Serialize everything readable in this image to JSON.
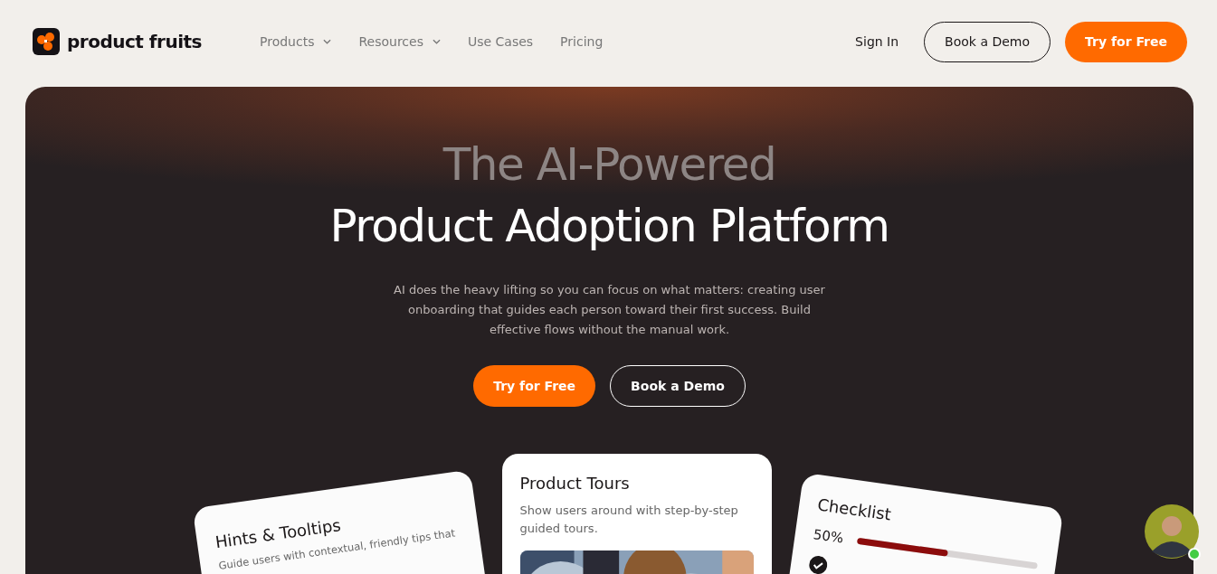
{
  "nav": {
    "logo": "product fruits",
    "links": [
      {
        "label": "Products",
        "dropdown": true
      },
      {
        "label": "Resources",
        "dropdown": true
      },
      {
        "label": "Use Cases",
        "dropdown": false
      },
      {
        "label": "Pricing",
        "dropdown": false
      }
    ],
    "sign_in": "Sign In",
    "book_demo": "Book a Demo",
    "try_free": "Try for Free"
  },
  "hero": {
    "title_line1": "The AI-Powered",
    "title_line2": "Product Adoption Platform",
    "subtitle": "AI does the heavy lifting so you can focus on what matters: creating user onboarding that guides each person toward their first success. Build effective flows without the manual work.",
    "primary_button": "Try for Free",
    "secondary_button": "Book a Demo"
  },
  "cards": [
    {
      "kind": "hints",
      "title": "Hints & Tooltips",
      "text": "Guide users with contextual, friendly tips that"
    },
    {
      "kind": "tours",
      "title": "Product Tours",
      "text": "Show users around with step-by-step guided tours."
    },
    {
      "kind": "checklist",
      "title": "Checklist",
      "percent": "50%",
      "level": 0.5
    }
  ],
  "chat": {
    "online": true
  }
}
